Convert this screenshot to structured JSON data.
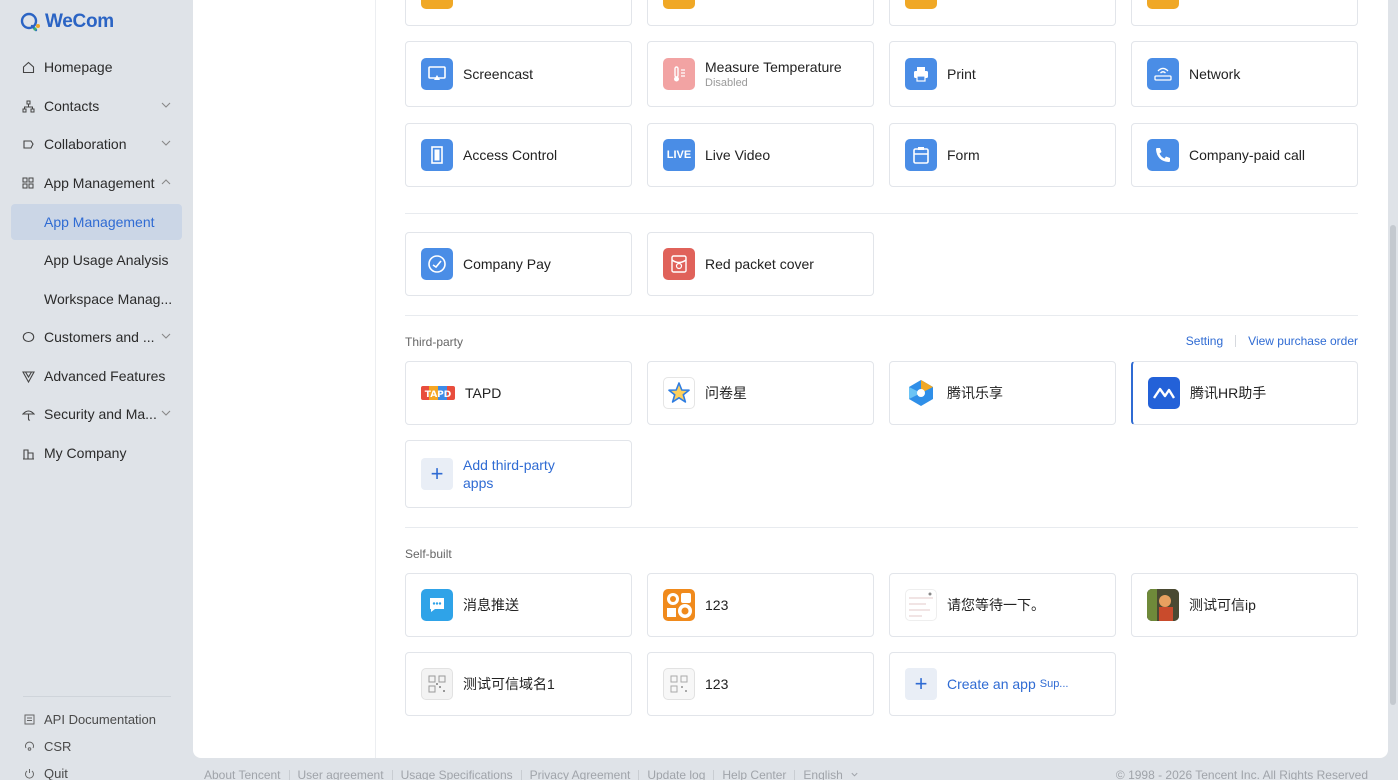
{
  "brand": {
    "name": "WeCom"
  },
  "sidebar": {
    "items": [
      {
        "label": "Homepage"
      },
      {
        "label": "Contacts"
      },
      {
        "label": "Collaboration"
      },
      {
        "label": "App Management"
      },
      {
        "label": "App Management"
      },
      {
        "label": "App Usage Analysis"
      },
      {
        "label": "Workspace Manag..."
      },
      {
        "label": "Customers and ..."
      },
      {
        "label": "Advanced Features"
      },
      {
        "label": "Security and Ma..."
      },
      {
        "label": "My Company"
      }
    ],
    "footer": [
      {
        "label": "API Documentation"
      },
      {
        "label": "CSR"
      },
      {
        "label": "Quit"
      }
    ]
  },
  "apps": {
    "basic": [
      {
        "label": "Screencast"
      },
      {
        "label": "Measure Temperature",
        "sub": "Disabled"
      },
      {
        "label": "Print"
      },
      {
        "label": "Network"
      },
      {
        "label": "Access Control"
      },
      {
        "label": "Live Video",
        "icon_text": "LIVE"
      },
      {
        "label": "Form"
      },
      {
        "label": "Company-paid call"
      }
    ],
    "pay": [
      {
        "label": "Company Pay"
      },
      {
        "label": "Red packet cover"
      }
    ],
    "third_party": {
      "title": "Third-party",
      "setting_link": "Setting",
      "purchase_link": "View purchase order",
      "items": [
        {
          "label": "TAPD",
          "icon_text": "TAPD"
        },
        {
          "label": "问卷星"
        },
        {
          "label": "腾讯乐享"
        },
        {
          "label": "腾讯HR助手"
        }
      ],
      "add_label": "Add third-party apps"
    },
    "self_built": {
      "title": "Self-built",
      "items": [
        {
          "label": "消息推送"
        },
        {
          "label": "123"
        },
        {
          "label": "请您等待一下。"
        },
        {
          "label": "测试可信ip"
        },
        {
          "label": "测试可信域名1"
        },
        {
          "label": "123"
        }
      ],
      "create_label": "Create an app",
      "create_sub": "Sup..."
    }
  },
  "footer": {
    "links": [
      "About Tencent",
      "User agreement",
      "Usage Specifications",
      "Privacy Agreement",
      "Update log",
      "Help Center",
      "English"
    ],
    "copyright": "© 1998 - 2026 Tencent Inc. All Rights Reserved"
  },
  "colors": {
    "accent": "#2f6bd3",
    "sidebar_bg": "#dfe3e8",
    "active_bg": "#cbd6e6",
    "icon_blue": "#4a8de6",
    "icon_orange": "#f0a826",
    "icon_red": "#e0625a",
    "icon_pink": "#f2a3a3"
  }
}
